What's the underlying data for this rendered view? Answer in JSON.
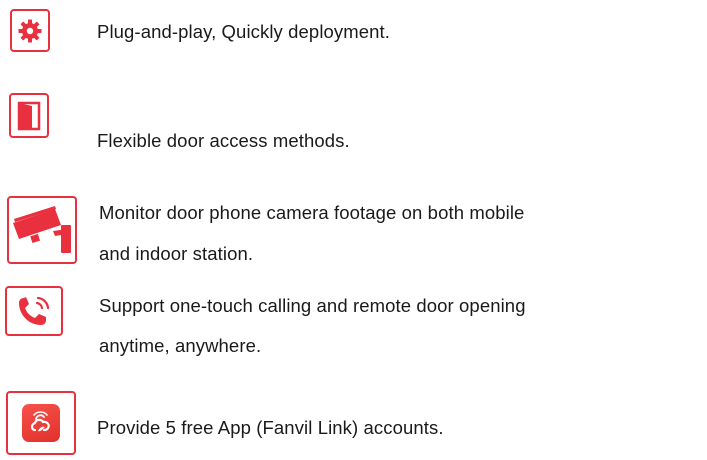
{
  "accent_color": "#e8303f",
  "features": [
    {
      "icon": "gear-icon",
      "text": "Plug-and-play, Quickly deployment."
    },
    {
      "icon": "door-icon",
      "text": "Flexible door access methods."
    },
    {
      "icon": "security-camera-icon",
      "line1": "Monitor door phone camera footage on both mobile",
      "line2": "and indoor station."
    },
    {
      "icon": "phone-call-icon",
      "line1": "Support one-touch calling and remote door opening",
      "line2": "anytime, anywhere."
    },
    {
      "icon": "fanvil-link-app-icon",
      "text": "Provide 5 free App (Fanvil Link) accounts."
    }
  ]
}
